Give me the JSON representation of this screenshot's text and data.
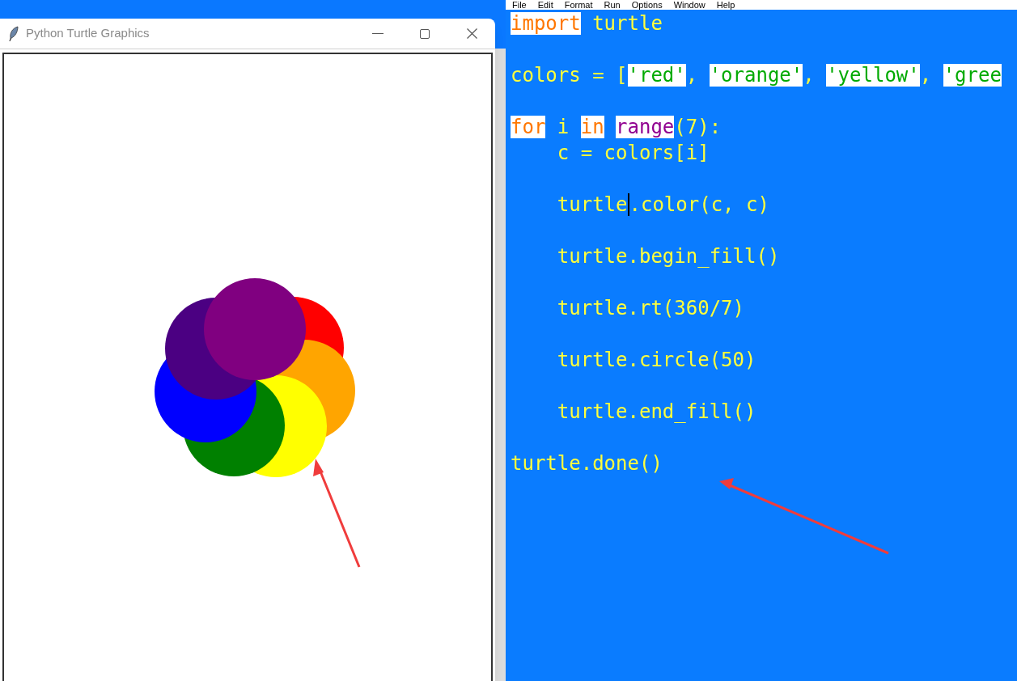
{
  "turtle_window": {
    "title": "Python Turtle Graphics"
  },
  "editor": {
    "menu": [
      "File",
      "Edit",
      "Format",
      "Run",
      "Options",
      "Window",
      "Help"
    ],
    "lines": [
      {
        "blank_before": false,
        "tokens": [
          {
            "kind": "keyword",
            "text": "import"
          },
          {
            "kind": "plain",
            "text": " turtle"
          }
        ]
      },
      {
        "blank_before": true,
        "tokens": [
          {
            "kind": "plain",
            "text": "colors = ["
          },
          {
            "kind": "string",
            "text": "'red'"
          },
          {
            "kind": "plain",
            "text": ", "
          },
          {
            "kind": "string",
            "text": "'orange'"
          },
          {
            "kind": "plain",
            "text": ", "
          },
          {
            "kind": "string",
            "text": "'yellow'"
          },
          {
            "kind": "plain",
            "text": ", "
          },
          {
            "kind": "string",
            "text": "'gree"
          }
        ]
      },
      {
        "blank_before": true,
        "tokens": [
          {
            "kind": "keyword",
            "text": "for"
          },
          {
            "kind": "plain",
            "text": " i "
          },
          {
            "kind": "keyword",
            "text": "in"
          },
          {
            "kind": "builtin",
            "text": "range",
            "space_before": true
          },
          {
            "kind": "plain",
            "text": "(7):"
          }
        ]
      },
      {
        "blank_before": false,
        "tokens": [
          {
            "kind": "plain",
            "text": "    c = colors[i]"
          }
        ]
      },
      {
        "blank_before": true,
        "tokens": [
          {
            "kind": "plain",
            "text": "    turtle"
          },
          {
            "kind": "cursor"
          },
          {
            "kind": "plain",
            "text": ".color(c, c)"
          }
        ]
      },
      {
        "blank_before": true,
        "tokens": [
          {
            "kind": "plain",
            "text": "    turtle.begin_fill()"
          }
        ]
      },
      {
        "blank_before": true,
        "tokens": [
          {
            "kind": "plain",
            "text": "    turtle.rt(360/7)"
          }
        ]
      },
      {
        "blank_before": true,
        "tokens": [
          {
            "kind": "plain",
            "text": "    turtle.circle(50)"
          }
        ]
      },
      {
        "blank_before": true,
        "tokens": [
          {
            "kind": "plain",
            "text": "    turtle.end_fill()"
          }
        ]
      },
      {
        "blank_before": true,
        "tokens": [
          {
            "kind": "plain",
            "text": "turtle.done()"
          }
        ]
      }
    ]
  }
}
